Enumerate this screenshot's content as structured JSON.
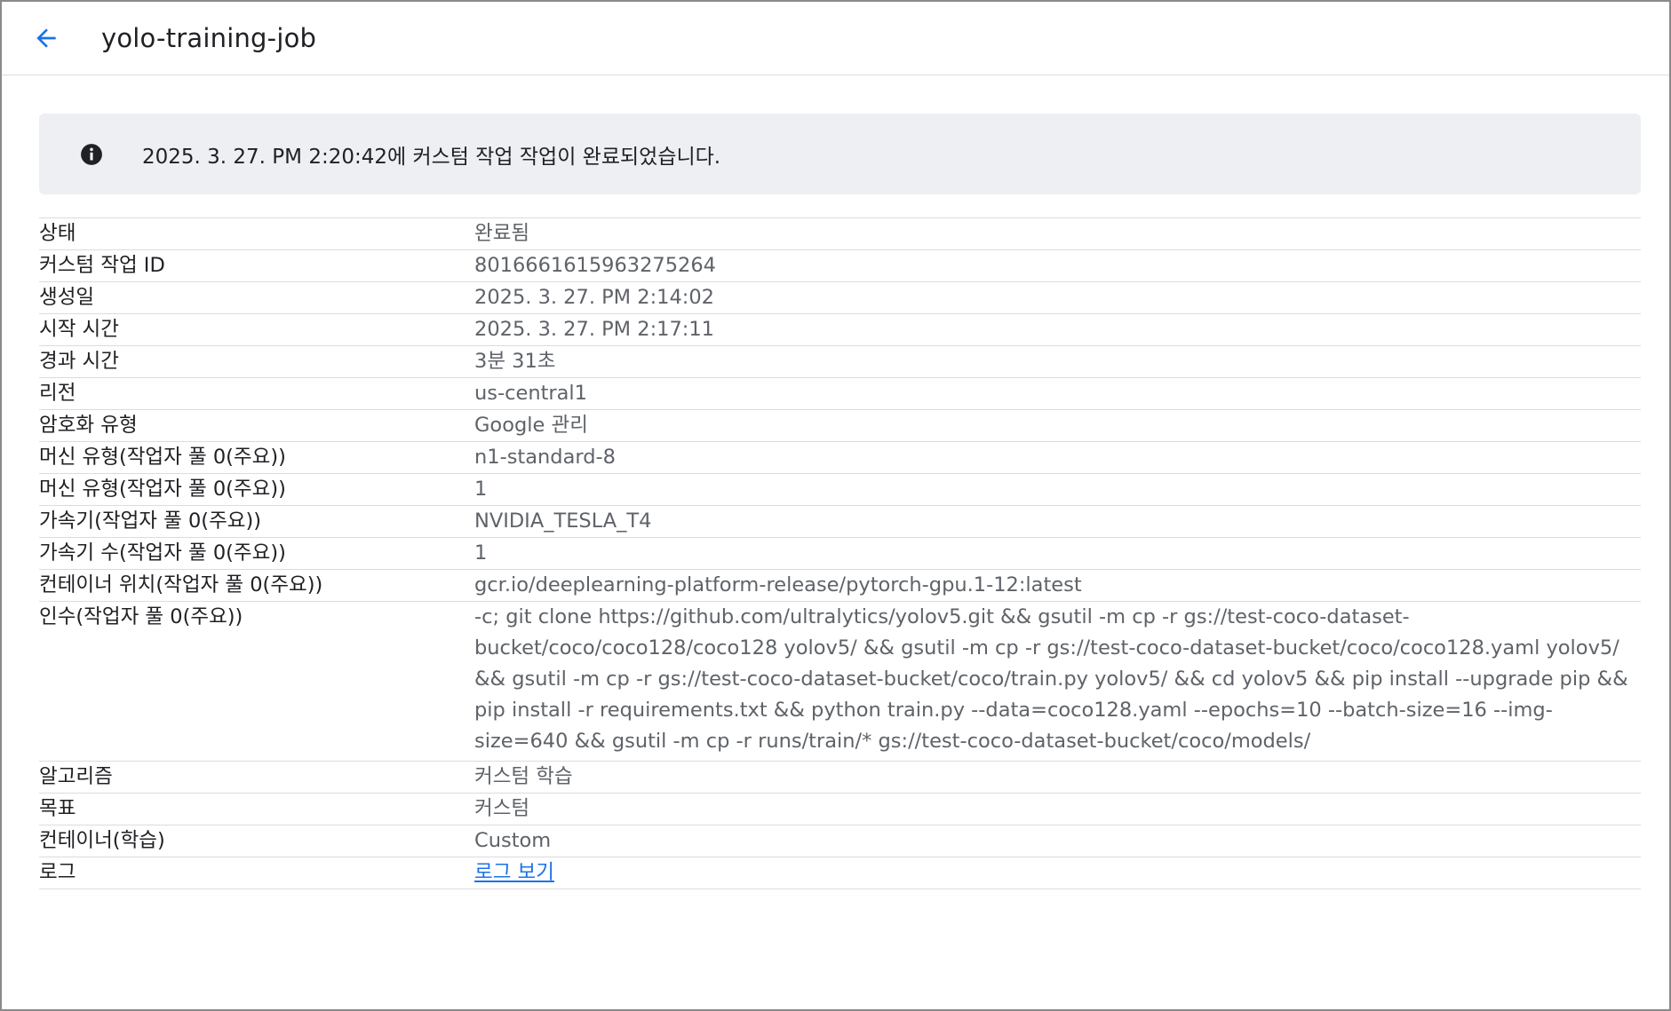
{
  "header": {
    "title": "yolo-training-job"
  },
  "banner": {
    "message": "2025. 3. 27. PM 2:20:42에 커스텀 작업 작업이 완료되었습니다."
  },
  "details": {
    "status": {
      "label": "상태",
      "value": "완료됨"
    },
    "job_id": {
      "label": "커스텀 작업 ID",
      "value": "8016661615963275264"
    },
    "created": {
      "label": "생성일",
      "value": "2025. 3. 27. PM 2:14:02"
    },
    "start_time": {
      "label": "시작 시간",
      "value": "2025. 3. 27. PM 2:17:11"
    },
    "elapsed": {
      "label": "경과 시간",
      "value": "3분 31초"
    },
    "region": {
      "label": "리전",
      "value": "us-central1"
    },
    "encryption": {
      "label": "암호화 유형",
      "value": "Google 관리"
    },
    "machine_type": {
      "label": "머신 유형(작업자 풀 0(주요))",
      "value": "n1-standard-8"
    },
    "machine_count": {
      "label": "머신 유형(작업자 풀 0(주요))",
      "value": "1"
    },
    "accelerator": {
      "label": "가속기(작업자 풀 0(주요))",
      "value": "NVIDIA_TESLA_T4"
    },
    "accelerator_count": {
      "label": "가속기 수(작업자 풀 0(주요))",
      "value": "1"
    },
    "container_location": {
      "label": "컨테이너 위치(작업자 풀 0(주요))",
      "value": "gcr.io/deeplearning-platform-release/pytorch-gpu.1-12:latest"
    },
    "args": {
      "label": "인수(작업자 풀 0(주요))",
      "value": "-c; git clone https://github.com/ultralytics/yolov5.git && gsutil -m cp -r gs://test-coco-dataset-bucket/coco/coco128/coco128 yolov5/ && gsutil -m cp -r gs://test-coco-dataset-bucket/coco/coco128.yaml yolov5/ && gsutil -m cp -r gs://test-coco-dataset-bucket/coco/train.py yolov5/ && cd yolov5 && pip install --upgrade pip && pip install -r requirements.txt && python train.py --data=coco128.yaml --epochs=10 --batch-size=16 --img-size=640 && gsutil -m cp -r runs/train/* gs://test-coco-dataset-bucket/coco/models/"
    },
    "algorithm": {
      "label": "알고리즘",
      "value": "커스텀 학습"
    },
    "objective": {
      "label": "목표",
      "value": "커스텀"
    },
    "container": {
      "label": "컨테이너(학습)",
      "value": "Custom"
    },
    "logs": {
      "label": "로그",
      "value": "로그 보기"
    }
  },
  "colors": {
    "accent": "#1a73e8",
    "banner_bg": "#eeeff2",
    "value_text": "#5f6368",
    "divider": "#dadce0"
  },
  "icons": {
    "back": "arrow-back-icon",
    "info": "info-icon"
  }
}
